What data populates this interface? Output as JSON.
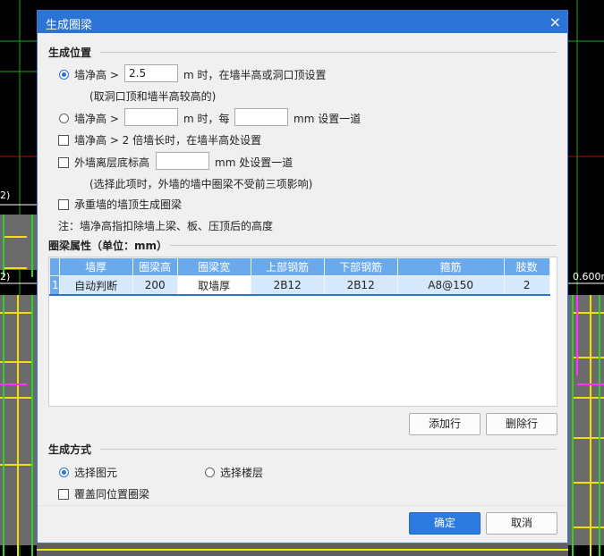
{
  "background": {
    "labels": [
      "2)",
      "2)",
      "0.600m"
    ]
  },
  "dialog": {
    "title": "生成圈梁",
    "close_glyph": "×"
  },
  "position_section": {
    "title": "生成位置",
    "opt1": {
      "label": "墙净高 >",
      "value": "2.5",
      "suffix": "m 时，在墙半高或洞口顶设置",
      "note": "(取洞口顶和墙半高较高的)",
      "selected": true
    },
    "opt2": {
      "label": "墙净高 >",
      "value": "",
      "mid": "m 时，每",
      "value2": "",
      "suffix": "mm 设置一道",
      "selected": false
    },
    "check1": {
      "label": "墙净高 > 2 倍墙长时，在墙半高处设置",
      "checked": false
    },
    "check2": {
      "label": "外墙离层底标高",
      "value": "",
      "suffix": "mm 处设置一道",
      "note": "(选择此项时，外墙的墙中圈梁不受前三项影响)",
      "checked": false
    },
    "check3": {
      "label": "承重墙的墙顶生成圈梁",
      "checked": false
    },
    "footnote": "注：墙净高指扣除墙上梁、板、压顶后的高度"
  },
  "props_section": {
    "title": "圈梁属性（单位：mm）",
    "columns": [
      "墙厚",
      "圈梁高",
      "圈梁宽",
      "上部钢筋",
      "下部钢筋",
      "箍筋",
      "肢数"
    ],
    "rows": [
      {
        "num": "1",
        "cells": [
          "自动判断",
          "200",
          "取墙厚",
          "2B12",
          "2B12",
          "A8@150",
          "2"
        ]
      }
    ],
    "add_button": "添加行",
    "delete_button": "删除行"
  },
  "method_section": {
    "title": "生成方式",
    "opt_element": {
      "label": "选择图元",
      "selected": true
    },
    "opt_floor": {
      "label": "选择楼层",
      "selected": false
    },
    "overwrite": {
      "label": "覆盖同位置圈梁",
      "checked": false
    }
  },
  "footer": {
    "ok": "确定",
    "cancel": "取消"
  },
  "colors": {
    "accent": "#2b74d6",
    "table_header": "#6aa9ec",
    "table_row": "#d6e8fb"
  }
}
